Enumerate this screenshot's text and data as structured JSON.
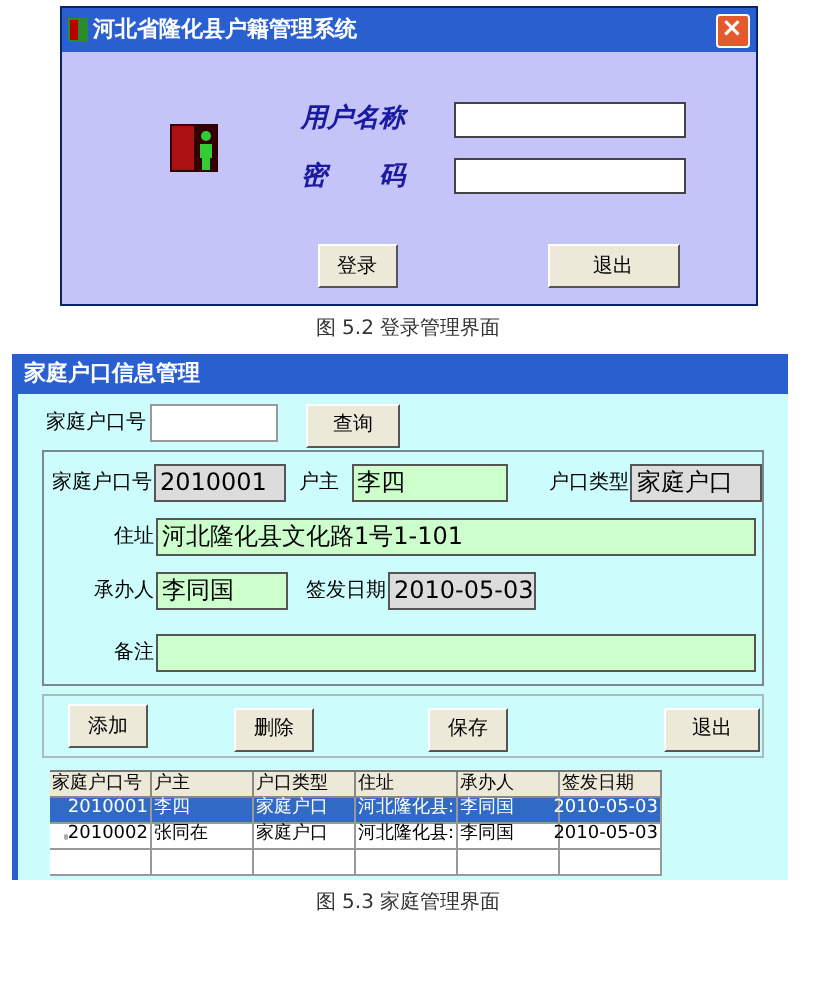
{
  "login_window": {
    "title": "河北省隆化县户籍管理系统",
    "close": "×",
    "fields": [
      {
        "label": "用户名称"
      },
      {
        "label": "密　　码"
      }
    ],
    "buttons": [
      "登录",
      "退出"
    ]
  },
  "caption_1": "图 5.2  登录管理界面",
  "family_window": {
    "title": "家庭户口信息管理",
    "search": {
      "label": "家庭户口号",
      "button": "查询"
    },
    "details": [
      {
        "label": "家庭户口号",
        "value": "2010001",
        "kind": "readonly"
      },
      {
        "label": "户主",
        "value": "李四",
        "kind": "editable"
      },
      {
        "label": "户口类型",
        "value": "家庭户口",
        "kind": "readonly"
      },
      {
        "label": "住址",
        "value": "河北隆化县文化路1号1-101",
        "kind": "editable"
      },
      {
        "label": "承办人",
        "value": "李同国",
        "kind": "editable"
      },
      {
        "label": "签发日期",
        "value": "2010-05-03",
        "kind": "readonly"
      },
      {
        "label": "备注",
        "kind": "editable"
      }
    ],
    "buttons": [
      "添加",
      "删除",
      "保存",
      "退出"
    ],
    "table": {
      "columns": [
        "家庭户口号",
        "户主",
        "户口类型",
        "住址",
        "承办人",
        "签发日期"
      ],
      "rows": [
        {
          "cells": [
            "2010001",
            "李四",
            "家庭户口",
            "河北隆化县:",
            "李同国",
            "2010-05-03"
          ],
          "selected": true
        },
        {
          "cells": [
            "2010002",
            "张同在",
            "家庭户口",
            "河北隆化县:",
            "李同国",
            "2010-05-03"
          ],
          "selected": false
        }
      ]
    }
  },
  "caption_2": "图 5.3  家庭管理界面"
}
